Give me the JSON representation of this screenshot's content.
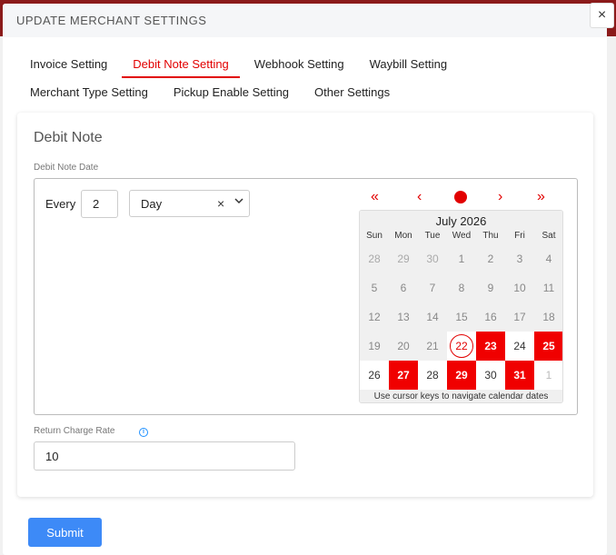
{
  "modal": {
    "title": "UPDATE MERCHANT SETTINGS",
    "close": "×"
  },
  "tabs": [
    {
      "label": "Invoice Setting"
    },
    {
      "label": "Debit Note Setting"
    },
    {
      "label": "Webhook Setting"
    },
    {
      "label": "Waybill Setting"
    },
    {
      "label": "Merchant Type Setting"
    },
    {
      "label": "Pickup Enable Setting"
    },
    {
      "label": "Other Settings"
    }
  ],
  "card": {
    "title": "Debit Note",
    "date_label": "Debit Note Date",
    "every_label": "Every",
    "every_value": "2",
    "unit_value": "Day",
    "clear_icon": "×",
    "arrow_icon": "⌄"
  },
  "calendar": {
    "month": "July 2026",
    "weekdays": [
      "Sun",
      "Mon",
      "Tue",
      "Wed",
      "Thu",
      "Fri",
      "Sat"
    ],
    "nav": {
      "prev_year": "«",
      "prev": "‹",
      "next": "›",
      "next_year": "»"
    },
    "days": [
      "28",
      "29",
      "30",
      "1",
      "2",
      "3",
      "4",
      "5",
      "6",
      "7",
      "8",
      "9",
      "10",
      "11",
      "12",
      "13",
      "14",
      "15",
      "16",
      "17",
      "18",
      "19",
      "20",
      "21",
      "22",
      "23",
      "24",
      "25",
      "26",
      "27",
      "28",
      "29",
      "30",
      "31",
      "1"
    ],
    "today": "22",
    "selected": [
      "23",
      "25",
      "27",
      "29",
      "31"
    ],
    "hint": "Use cursor keys to navigate calendar dates",
    "accent": "#e20000"
  },
  "rate": {
    "label": "Return Charge Rate",
    "info_icon": "i",
    "value": "10"
  },
  "submit": "Submit"
}
